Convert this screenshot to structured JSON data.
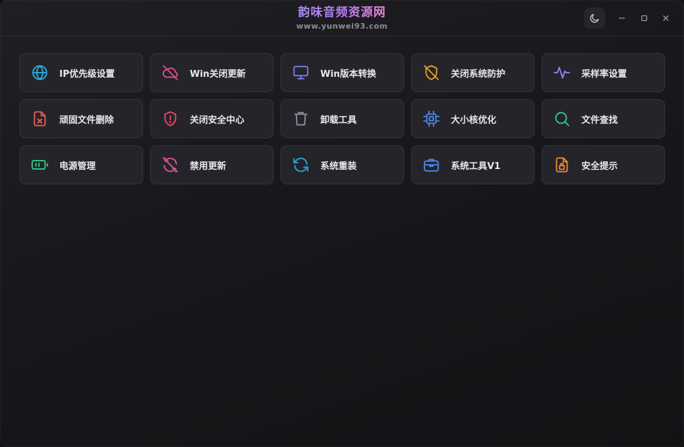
{
  "header": {
    "title": "韵味音频资源网",
    "subtitle": "www.yunwei93.com"
  },
  "controls": {
    "theme_icon": "moon-icon",
    "minimize_icon": "minimize-icon",
    "maximize_icon": "maximize-icon",
    "close_icon": "close-icon"
  },
  "tools": [
    {
      "label": "IP优先级设置",
      "icon": "globe-icon",
      "color": "#2bb0e6"
    },
    {
      "label": "Win关闭更新",
      "icon": "cloud-off-icon",
      "color": "#e0508a"
    },
    {
      "label": "Win版本转换",
      "icon": "monitor-icon",
      "color": "#7b7cf5"
    },
    {
      "label": "关闭系统防护",
      "icon": "shield-off-icon",
      "color": "#e7a021"
    },
    {
      "label": "采样率设置",
      "icon": "waveform-icon",
      "color": "#a07df5"
    },
    {
      "label": "顽固文件删除",
      "icon": "file-delete-icon",
      "color": "#ef5d4f"
    },
    {
      "label": "关闭安全中心",
      "icon": "shield-alert-icon",
      "color": "#ea4a68"
    },
    {
      "label": "卸载工具",
      "icon": "trash-icon",
      "color": "#8e9098"
    },
    {
      "label": "大小核优化",
      "icon": "cpu-icon",
      "color": "#4d86ec"
    },
    {
      "label": "文件查找",
      "icon": "search-icon",
      "color": "#33c99a"
    },
    {
      "label": "电源管理",
      "icon": "battery-icon",
      "color": "#2fcf86"
    },
    {
      "label": "禁用更新",
      "icon": "refresh-off-icon",
      "color": "#e2559b"
    },
    {
      "label": "系统重装",
      "icon": "refresh-icon",
      "color": "#2aa9dd"
    },
    {
      "label": "系统工具V1",
      "icon": "toolbox-icon",
      "color": "#4d86ec"
    },
    {
      "label": "安全提示",
      "icon": "file-lock-icon",
      "color": "#ef8a2c"
    }
  ]
}
